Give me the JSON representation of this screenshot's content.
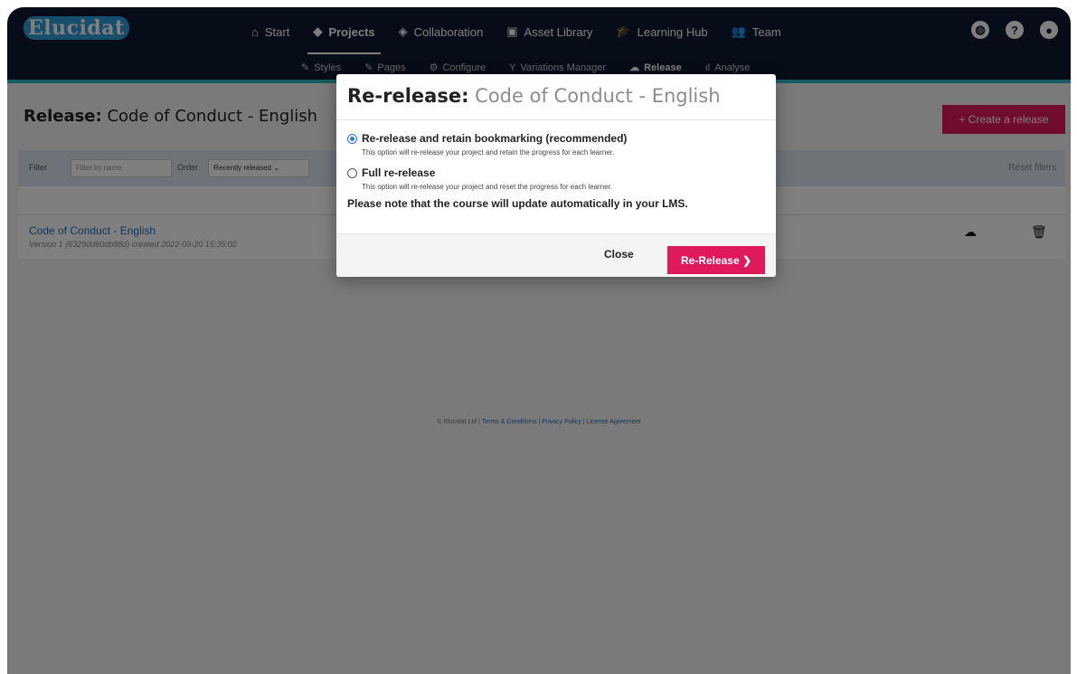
{
  "app": {
    "logo": "Elucidat"
  },
  "nav": {
    "items": [
      {
        "label": "Start",
        "icon": "⌂"
      },
      {
        "label": "Projects",
        "icon": "◆"
      },
      {
        "label": "Collaboration",
        "icon": "◈"
      },
      {
        "label": "Asset Library",
        "icon": "▣"
      },
      {
        "label": "Learning Hub",
        "icon": "🎓"
      },
      {
        "label": "Team",
        "icon": "👥"
      }
    ],
    "active": "Projects"
  },
  "subnav": {
    "items": [
      {
        "label": "Styles",
        "icon": "✎"
      },
      {
        "label": "Pages",
        "icon": "✎"
      },
      {
        "label": "Configure",
        "icon": "⚙"
      },
      {
        "label": "Variations Manager",
        "icon": "Y"
      },
      {
        "label": "Release",
        "icon": "☁"
      },
      {
        "label": "Analyse",
        "icon": "ıl"
      }
    ],
    "active": "Release"
  },
  "page": {
    "title_bold": "Release:",
    "title_rest": "Code of Conduct - English",
    "create_button": "+ Create a release"
  },
  "filters": {
    "filter_label": "Filter",
    "filter_placeholder": "Filter by name",
    "order_label": "Order",
    "order_value": "Recently released",
    "reset_label": "Reset filters"
  },
  "releases": [
    {
      "title": "Code of Conduct - English",
      "meta": "Version 1 (6329dd60db88d) created 2022-09-20 15:35:02"
    }
  ],
  "footer": {
    "copyright": "© Elucidat Ltd |",
    "terms": "Terms & Conditions",
    "privacy": "Privacy Policy",
    "license": "License Agreement",
    "sep": "|"
  },
  "modal": {
    "title_bold": "Re-release:",
    "title_rest": "Code of Conduct - English",
    "options": [
      {
        "label": "Re-release and retain bookmarking (recommended)",
        "description": "This option will re-release your project and retain the progress for each learner.",
        "selected": true
      },
      {
        "label": "Full re-release",
        "description": "This option will re-release your project and reset the progress for each learner.",
        "selected": false
      }
    ],
    "note": "Please note that the course will update automatically in your LMS.",
    "close_label": "Close",
    "confirm_label": "Re-Release ❯"
  },
  "colors": {
    "nav_bg": "#0d1a33",
    "accent": "#e0195c",
    "teal": "#2fb8c7",
    "link": "#1f6fb8"
  }
}
